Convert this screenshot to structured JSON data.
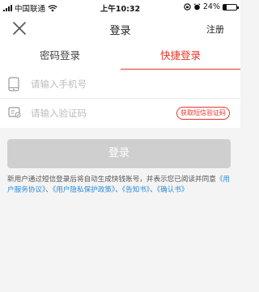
{
  "status_bar": {
    "carrier": "中国联通",
    "time": "上午10:32",
    "battery": "24%",
    "battery_level": 0.24
  },
  "nav": {
    "title": "登录",
    "register": "注册",
    "close_icon": "close-icon"
  },
  "tabs": [
    {
      "label": "密码登录",
      "active": false
    },
    {
      "label": "快捷登录",
      "active": true
    }
  ],
  "form": {
    "phone_placeholder": "请输入手机号",
    "phone_value": "",
    "code_placeholder": "请输入验证码",
    "code_value": "",
    "sms_button": "获取短信验证码"
  },
  "login_button": "登录",
  "notice": {
    "text": "新用户通过短信登录后将自动生成快钱账号，并表示您已阅读并同意",
    "link1": "《用户服务协议》",
    "sep1": "、",
    "link2": "《用户隐私保护政策》",
    "sep2": "、",
    "link3": "《告知书》",
    "sep3": "、",
    "link4": "《确认书》"
  },
  "colors": {
    "accent": "#e6372a",
    "link": "#2f8cd8",
    "button_disabled": "#cfcfcf",
    "background": "#f4f4f4"
  }
}
